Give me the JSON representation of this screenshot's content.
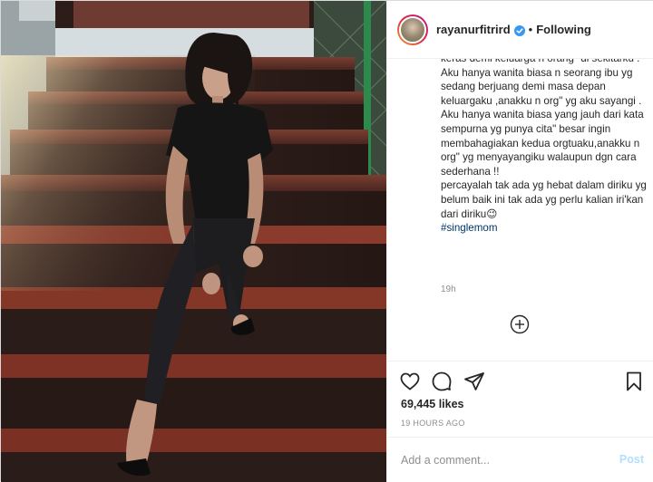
{
  "post": {
    "photo": {
      "icon": "post-photo-woman-on-stairs"
    },
    "header": {
      "username": "rayanurfitrird",
      "separator": "•",
      "follow_status": "Following",
      "verified_icon": "verified-badge-icon",
      "accent_color": "#3897f0"
    },
    "caption": {
      "text": "keras demi keluarga n orang\" di sekitarku . Aku hanya wanita biasa n seorang ibu yg sedang berjuang demi masa depan keluargaku ,anakku n org\" yg aku sayangi . Aku hanya wanita biasa yang jauh dari kata sempurna yg punya cita\" besar ingin membahagiakan kedua orgtuaku,anakku n org\" yg menyayangiku walaupun dgn cara sederhana !!\npercayalah tak ada yg hebat dalam diriku yg belum baik ini tak ada yg perlu kalian iri'kan dari diriku😉\n",
      "hashtag": "#singlemom",
      "hashtag_color": "#00376b",
      "time": "19h"
    },
    "load_more_icon": "plus-circle-icon",
    "actions": {
      "like_icon": "heart-icon",
      "comment_icon": "comment-icon",
      "share_icon": "paper-plane-icon",
      "save_icon": "bookmark-icon"
    },
    "likes": "69,445 likes",
    "timestamp": "19 HOURS AGO",
    "comment": {
      "placeholder": "Add a comment...",
      "value": "",
      "post_label": "Post",
      "post_color": "#b2dffc"
    }
  }
}
